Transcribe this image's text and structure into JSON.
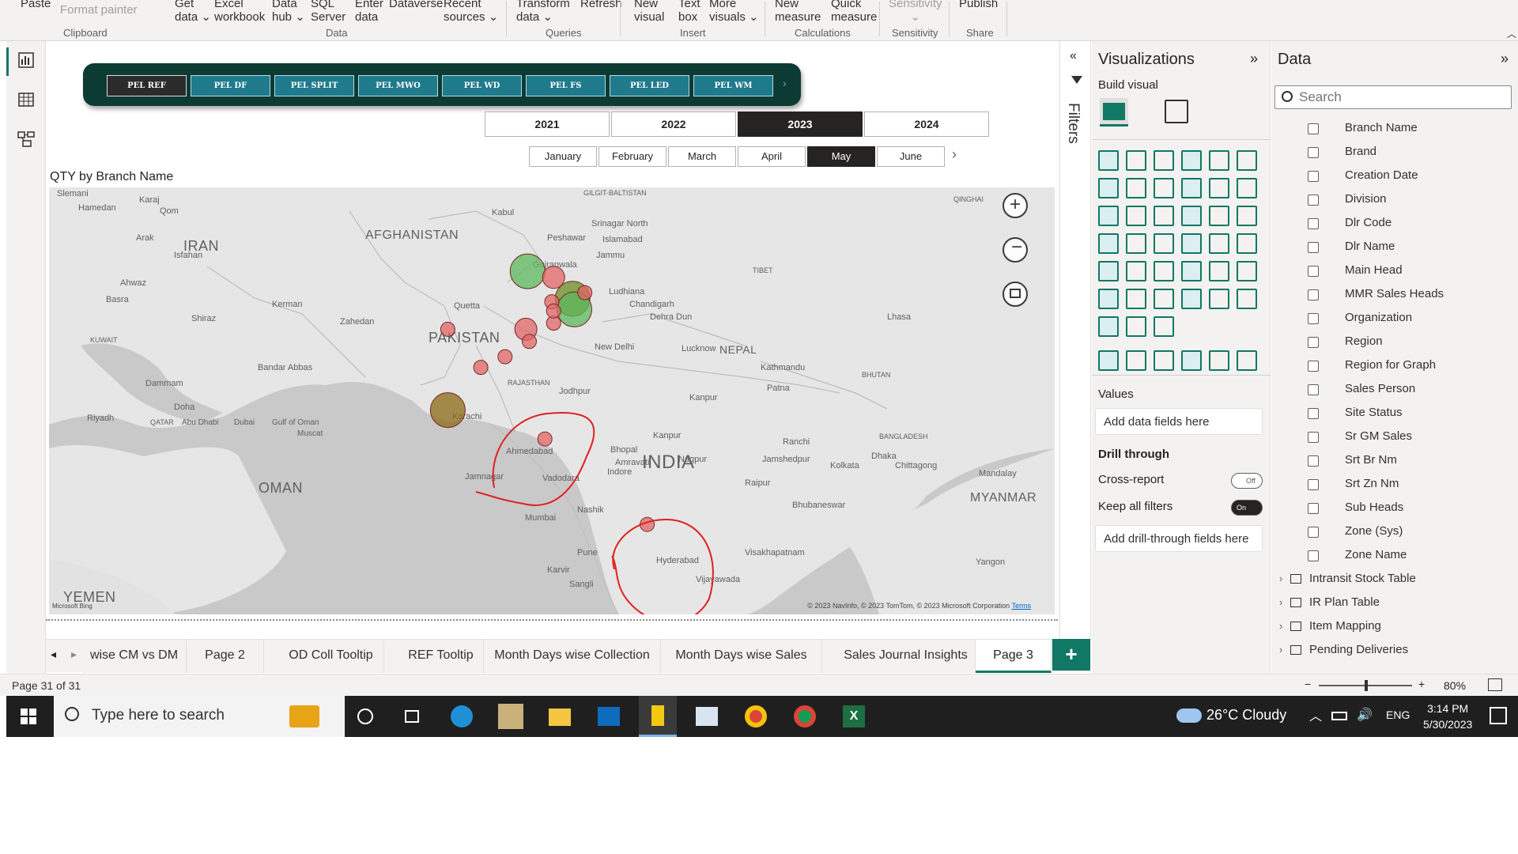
{
  "ribbon": {
    "buttons": [
      {
        "id": "paste",
        "label": "Paste"
      },
      {
        "id": "format-painter",
        "label": "Format painter"
      },
      {
        "id": "get-data",
        "label": "Get\ndata ⌄"
      },
      {
        "id": "excel-workbook",
        "label": "Excel\nworkbook"
      },
      {
        "id": "data-hub",
        "label": "Data\nhub ⌄"
      },
      {
        "id": "sql-server",
        "label": "SQL\nServer"
      },
      {
        "id": "enter-data",
        "label": "Enter\ndata"
      },
      {
        "id": "dataverse",
        "label": "Dataverse"
      },
      {
        "id": "recent-sources",
        "label": "Recent\nsources ⌄"
      },
      {
        "id": "transform-data",
        "label": "Transform\ndata ⌄"
      },
      {
        "id": "refresh",
        "label": "Refresh"
      },
      {
        "id": "new-visual",
        "label": "New\nvisual"
      },
      {
        "id": "text-box",
        "label": "Text\nbox"
      },
      {
        "id": "more-visuals",
        "label": "More\nvisuals ⌄"
      },
      {
        "id": "new-measure",
        "label": "New\nmeasure"
      },
      {
        "id": "quick-measure",
        "label": "Quick\nmeasure"
      },
      {
        "id": "sensitivity",
        "label": "Sensitivity\n⌄"
      },
      {
        "id": "publish",
        "label": "Publish"
      }
    ],
    "groups": [
      "Clipboard",
      "Data",
      "Queries",
      "Insert",
      "Calculations",
      "Sensitivity",
      "Share"
    ]
  },
  "slicer": {
    "buttons": [
      "PEL REF",
      "PEL DF",
      "PEL SPLIT",
      "PEL MWO",
      "PEL WD",
      "PEL FS",
      "PEL LED",
      "PEL WM"
    ],
    "active": "PEL REF"
  },
  "years": {
    "items": [
      "2021",
      "2022",
      "2023",
      "2024"
    ],
    "active": "2023"
  },
  "months": {
    "items": [
      "January",
      "February",
      "March",
      "April",
      "May",
      "June"
    ],
    "active": "May"
  },
  "map": {
    "title": "QTY by Branch Name",
    "countries": [
      "IRAN",
      "AFGHANISTAN",
      "PAKISTAN",
      "INDIA",
      "NEPAL",
      "OMAN",
      "YEMEN",
      "MYANMAR"
    ],
    "places": [
      "Slemani",
      "Karaj",
      "Qom",
      "Hamedan",
      "Arak",
      "Isfahan",
      "Ahwaz",
      "Basra",
      "Shiraz",
      "Kerman",
      "Zahedan",
      "KUWAIT",
      "Dammam",
      "Riyadh",
      "Doha",
      "QATAR",
      "Abu Dhabi",
      "Dubai",
      "Gulf of Oman",
      "Muscat",
      "Bandar Abbas",
      "Kabul",
      "Peshawar",
      "Islamabad",
      "Srinagar North",
      "GILGIT-BALTISTAN",
      "Gujranwala",
      "Jammu",
      "Ludhiana",
      "Chandigarh",
      "Quetta",
      "Dehra Dun",
      "New Delhi",
      "Lucknow",
      "Karachi",
      "Jodhpur",
      "RAJASTHAN",
      "Ahmedabad",
      "Jamnagar",
      "Vadodara",
      "Bhopal",
      "Nagpur",
      "Raipur",
      "Nashik",
      "Mumbai",
      "Pune",
      "Hyderabad",
      "Vijayawada",
      "Visakhapatnam",
      "Bhubaneswar",
      "Kolkata",
      "BANGLADESH",
      "Chittagong",
      "Dhaka",
      "Mandalay",
      "Lhasa",
      "TIBET",
      "QINGHAI",
      "BHUTAN",
      "Kathmandu",
      "Patna",
      "Kanpur",
      "Ranchi",
      "Jamshedpur",
      "Sangli",
      "Karvir",
      "Yangon",
      "Kanpur",
      "Indore",
      "Amravati"
    ],
    "copyright": "© 2023 NavInfo, © 2023 TomTom, © 2023 Microsoft Corporation",
    "terms": "Terms",
    "attribution": "Microsoft Bing"
  },
  "chart_data": {
    "type": "map-bubble",
    "title": "QTY by Branch Name",
    "bubbles": [
      {
        "lat": 34.0,
        "lon": 71.6,
        "size": "large",
        "color": "#5cb85c"
      },
      {
        "lat": 33.6,
        "lon": 73.1,
        "size": "medium",
        "color": "#e06666"
      },
      {
        "lat": 32.2,
        "lon": 74.2,
        "size": "large",
        "color": "#6b8e23"
      },
      {
        "lat": 31.5,
        "lon": 74.3,
        "size": "large",
        "color": "#5cb85c"
      },
      {
        "lat": 32.6,
        "lon": 74.9,
        "size": "small",
        "color": "#e06666"
      },
      {
        "lat": 32.0,
        "lon": 73.0,
        "size": "small",
        "color": "#e06666"
      },
      {
        "lat": 30.2,
        "lon": 67.0,
        "size": "small",
        "color": "#e06666"
      },
      {
        "lat": 30.2,
        "lon": 71.5,
        "size": "medium",
        "color": "#e06666"
      },
      {
        "lat": 29.4,
        "lon": 71.7,
        "size": "small",
        "color": "#e06666"
      },
      {
        "lat": 30.6,
        "lon": 73.1,
        "size": "small",
        "color": "#e06666"
      },
      {
        "lat": 31.4,
        "lon": 73.1,
        "size": "small",
        "color": "#e06666"
      },
      {
        "lat": 28.4,
        "lon": 70.3,
        "size": "small",
        "color": "#e06666"
      },
      {
        "lat": 27.7,
        "lon": 68.9,
        "size": "small",
        "color": "#e06666"
      },
      {
        "lat": 24.9,
        "lon": 67.0,
        "size": "large",
        "color": "#8b6914"
      },
      {
        "lat": 23.0,
        "lon": 72.6,
        "size": "small",
        "color": "#e06666"
      },
      {
        "lat": 17.4,
        "lon": 78.5,
        "size": "small",
        "color": "#e06666"
      }
    ]
  },
  "tabs": {
    "items": [
      "wise CM vs DM",
      "Page 2",
      "OD Coll Tooltip",
      "REF Tooltip",
      "Month Days wise Collection",
      "Month Days wise Sales",
      "Sales Journal Insights",
      "Page 3"
    ],
    "active": "Page 3",
    "add": "+"
  },
  "status": {
    "page": "Page 31 of 31",
    "zoom": "80%"
  },
  "filters": {
    "label": "Filters"
  },
  "viz": {
    "title": "Visualizations",
    "build_visual": "Build visual",
    "values_label": "Values",
    "values_placeholder": "Add data fields here",
    "drill_title": "Drill through",
    "cross_report": "Cross-report",
    "cross_report_state": "Off",
    "keep_filters": "Keep all filters",
    "keep_filters_state": "On",
    "drill_placeholder": "Add drill-through fields here"
  },
  "datapane": {
    "title": "Data",
    "search_placeholder": "Search",
    "fields": [
      "Branch Name",
      "Brand",
      "Creation Date",
      "Division",
      "Dlr Code",
      "Dlr Name",
      "Main Head",
      "MMR Sales Heads",
      "Organization",
      "Region",
      "Region for Graph",
      "Sales Person",
      "Site Status",
      "Sr GM Sales",
      "Srt Br Nm",
      "Srt Zn Nm",
      "Sub Heads",
      "Zone (Sys)",
      "Zone Name"
    ],
    "tables": [
      "Intransit Stock Table",
      "IR Plan Table",
      "Item Mapping",
      "Pending Deliveries"
    ]
  },
  "taskbar": {
    "search_placeholder": "Type here to search",
    "weather": "26°C  Cloudy",
    "lang": "ENG",
    "time": "3:14 PM",
    "date": "5/30/2023"
  }
}
